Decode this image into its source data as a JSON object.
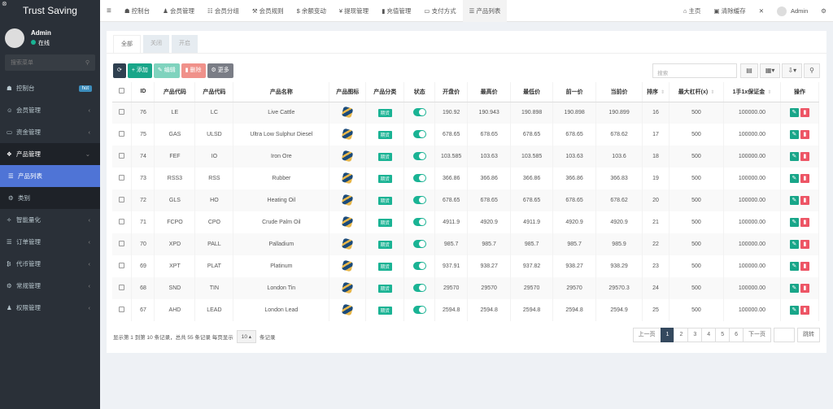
{
  "brand": "Trust Saving",
  "user": {
    "name": "Admin",
    "status": "在线"
  },
  "sidebar": {
    "search_placeholder": "搜索菜单",
    "items": [
      {
        "label": "控制台",
        "icon": "dashboard-icon",
        "badge": "hot"
      },
      {
        "label": "会员管理",
        "icon": "user-icon",
        "chev": "‹"
      },
      {
        "label": "资金管理",
        "icon": "money-icon",
        "chev": "‹"
      },
      {
        "label": "产品管理",
        "icon": "cubes-icon",
        "chev": "⌄"
      },
      {
        "label": "产品列表",
        "icon": "list-icon"
      },
      {
        "label": "类别",
        "icon": "gear-icon"
      },
      {
        "label": "智能量化",
        "icon": "magic-icon",
        "chev": "‹"
      },
      {
        "label": "订单管理",
        "icon": "list-icon",
        "chev": "‹"
      },
      {
        "label": "代币管理",
        "icon": "bitcoin-icon",
        "chev": "‹"
      },
      {
        "label": "常规管理",
        "icon": "cogs-icon",
        "chev": "‹"
      },
      {
        "label": "权限管理",
        "icon": "group-icon",
        "chev": "‹"
      }
    ]
  },
  "topnav": [
    {
      "label": "控制台",
      "icon": "☗"
    },
    {
      "label": "会员管理",
      "icon": "♟"
    },
    {
      "label": "会员分组",
      "icon": "☷"
    },
    {
      "label": "会员规则",
      "icon": "⚒"
    },
    {
      "label": "余额变动",
      "icon": "$"
    },
    {
      "label": "提现管理",
      "icon": "¥"
    },
    {
      "label": "充值管理",
      "icon": "▮"
    },
    {
      "label": "支付方式",
      "icon": "▭"
    },
    {
      "label": "产品列表",
      "icon": "☰"
    }
  ],
  "topright": {
    "home": "主页",
    "clear_cache": "清除缓存",
    "admin": "Admin"
  },
  "tabs": [
    "全部",
    "关闭",
    "开启"
  ],
  "toolbar": {
    "add": "添加",
    "edit": "编辑",
    "delete": "删除",
    "more": "更多",
    "search_placeholder": "搜索"
  },
  "columns": [
    "ID",
    "产品代码",
    "产品代码",
    "产品名称",
    "产品图标",
    "产品分类",
    "状态",
    "开盘价",
    "最高价",
    "最低价",
    "前一价",
    "当前价",
    "排序",
    "最大杠杆(x)",
    "1手1x保证金",
    "操作"
  ],
  "rows": [
    {
      "id": "76",
      "code1": "LE",
      "code2": "LC",
      "name": "Live Cattle",
      "cat": "期货",
      "open": "190.92",
      "high": "190.943",
      "low": "190.898",
      "prev": "190.898",
      "cur": "190.899",
      "sort": "16",
      "lev": "500",
      "margin": "100000.00"
    },
    {
      "id": "75",
      "code1": "GAS",
      "code2": "ULSD",
      "name": "Ultra Low Sulphur Diesel",
      "cat": "期货",
      "open": "678.65",
      "high": "678.65",
      "low": "678.65",
      "prev": "678.65",
      "cur": "678.62",
      "sort": "17",
      "lev": "500",
      "margin": "100000.00"
    },
    {
      "id": "74",
      "code1": "FEF",
      "code2": "IO",
      "name": "Iron Ore",
      "cat": "期货",
      "open": "103.585",
      "high": "103.63",
      "low": "103.585",
      "prev": "103.63",
      "cur": "103.6",
      "sort": "18",
      "lev": "500",
      "margin": "100000.00"
    },
    {
      "id": "73",
      "code1": "RSS3",
      "code2": "RSS",
      "name": "Rubber",
      "cat": "期货",
      "open": "366.86",
      "high": "366.86",
      "low": "366.86",
      "prev": "366.86",
      "cur": "366.83",
      "sort": "19",
      "lev": "500",
      "margin": "100000.00"
    },
    {
      "id": "72",
      "code1": "GLS",
      "code2": "HO",
      "name": "Heating Oil",
      "cat": "期货",
      "open": "678.65",
      "high": "678.65",
      "low": "678.65",
      "prev": "678.65",
      "cur": "678.62",
      "sort": "20",
      "lev": "500",
      "margin": "100000.00"
    },
    {
      "id": "71",
      "code1": "FCPO",
      "code2": "CPO",
      "name": "Crude Palm Oil",
      "cat": "期货",
      "open": "4911.9",
      "high": "4920.9",
      "low": "4911.9",
      "prev": "4920.9",
      "cur": "4920.9",
      "sort": "21",
      "lev": "500",
      "margin": "100000.00"
    },
    {
      "id": "70",
      "code1": "XPD",
      "code2": "PALL",
      "name": "Palladium",
      "cat": "期货",
      "open": "985.7",
      "high": "985.7",
      "low": "985.7",
      "prev": "985.7",
      "cur": "985.9",
      "sort": "22",
      "lev": "500",
      "margin": "100000.00"
    },
    {
      "id": "69",
      "code1": "XPT",
      "code2": "PLAT",
      "name": "Platinum",
      "cat": "期货",
      "open": "937.91",
      "high": "938.27",
      "low": "937.82",
      "prev": "938.27",
      "cur": "938.29",
      "sort": "23",
      "lev": "500",
      "margin": "100000.00"
    },
    {
      "id": "68",
      "code1": "SND",
      "code2": "TIN",
      "name": "London Tin",
      "cat": "期货",
      "open": "29570",
      "high": "29570",
      "low": "29570",
      "prev": "29570",
      "cur": "29570.3",
      "sort": "24",
      "lev": "500",
      "margin": "100000.00"
    },
    {
      "id": "67",
      "code1": "AHD",
      "code2": "LEAD",
      "name": "London Lead",
      "cat": "期货",
      "open": "2594.8",
      "high": "2594.8",
      "low": "2594.8",
      "prev": "2594.8",
      "cur": "2594.9",
      "sort": "25",
      "lev": "500",
      "margin": "100000.00"
    }
  ],
  "footer": {
    "summary": "显示第 1 到第 10 条记录，总共 55 条记录 每页显示",
    "page_size": "10 ▴",
    "suffix": "条记录"
  },
  "pager": {
    "prev": "上一页",
    "pages": [
      "1",
      "2",
      "3",
      "4",
      "5",
      "6"
    ],
    "current": "1",
    "next": "下一页",
    "jump": "跳转"
  }
}
